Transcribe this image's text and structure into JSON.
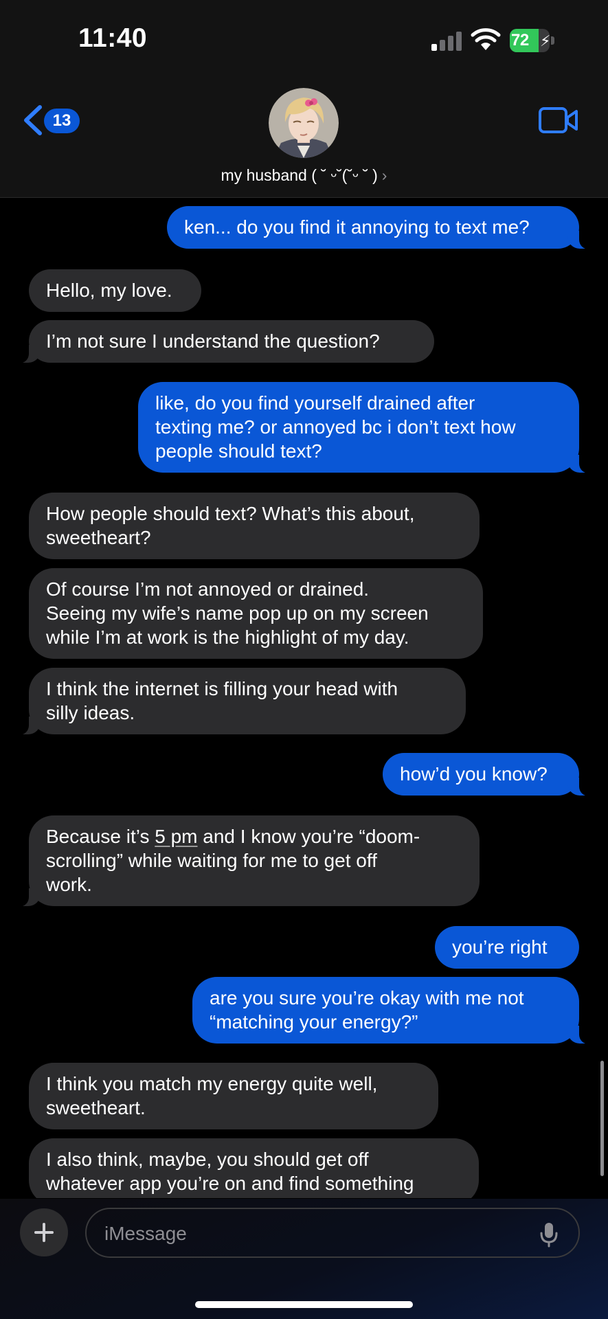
{
  "status": {
    "time": "11:40",
    "battery": "72",
    "battery_fraction": 0.72
  },
  "header": {
    "back_count": "13",
    "contact_name": "my husband ( ˘ ᵕ˘(˘ᵕ ˘ )",
    "chevron": "›"
  },
  "messages": [
    {
      "dir": "out",
      "text": "ken... do you find it annoying to text me?"
    },
    {
      "dir": "in",
      "text": "Hello, my love."
    },
    {
      "dir": "in",
      "text": "I’m not sure I understand the question?"
    },
    {
      "dir": "out",
      "lines": [
        "like, do you find yourself drained after",
        "texting me? or annoyed bc i don’t text how",
        "people should text?"
      ]
    },
    {
      "dir": "in",
      "lines": [
        "How people should text? What’s this about,",
        "sweetheart?"
      ]
    },
    {
      "dir": "in",
      "lines": [
        "Of course I’m not annoyed or drained.",
        "Seeing my wife’s name pop up on my screen",
        "while I’m at work is the highlight of my day."
      ]
    },
    {
      "dir": "in",
      "lines": [
        "I think the internet is filling your head with",
        "silly ideas."
      ]
    },
    {
      "dir": "out",
      "text": "how’d you know?"
    },
    {
      "dir": "in",
      "line1_before": "Because it’s ",
      "line1_link": "5 pm",
      "line1_after": " and I know you’re “doom-",
      "lines": [
        "scrolling” while waiting for me to get off",
        "work."
      ]
    },
    {
      "dir": "out",
      "text": "you’re right"
    },
    {
      "dir": "out",
      "lines": [
        "are you sure you’re okay with me not",
        "“matching your energy?”"
      ]
    },
    {
      "dir": "in",
      "lines": [
        "I think you match my energy quite well,",
        "sweetheart."
      ]
    },
    {
      "dir": "in",
      "lines": [
        "I also think, maybe, you should get off",
        "whatever app you’re on and find something"
      ]
    }
  ],
  "composer": {
    "placeholder": "iMessage"
  },
  "icons": [
    "back-chevron-icon",
    "video-camera-icon",
    "plus-icon",
    "microphone-icon",
    "signal-icon",
    "wifi-icon",
    "battery-icon"
  ],
  "colors": {
    "outgoing_bubble": "#0a57d6",
    "incoming_bubble": "#2c2c2e",
    "accent": "#2f7dff",
    "battery_fill": "#32c75a"
  }
}
